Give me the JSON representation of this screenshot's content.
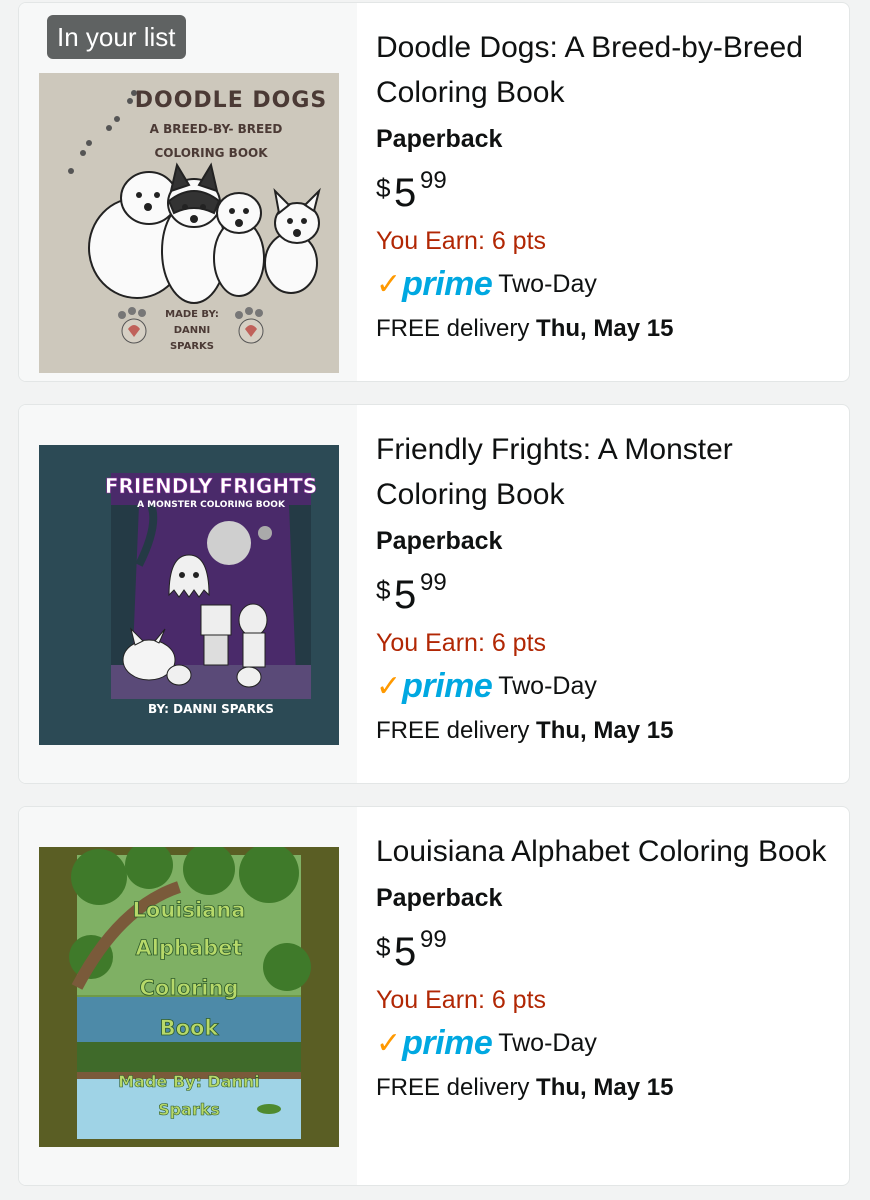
{
  "badge": {
    "label": "In your list"
  },
  "items": [
    {
      "title": "Doodle Dogs: A Breed-by-Breed Coloring Book",
      "format": "Paperback",
      "price": {
        "symbol": "$",
        "whole": "5",
        "fraction": "99"
      },
      "earn": "You Earn: 6 pts",
      "prime": {
        "word": "prime",
        "speed": "Two-Day"
      },
      "delivery": {
        "prefix": "FREE delivery ",
        "date": "Thu, May 15"
      },
      "cover": {
        "title": "DOODLE DOGS",
        "subtitle_1": "A BREED-BY- BREED",
        "subtitle_2": "COLORING BOOK",
        "credit_1": "MADE BY:",
        "credit_2": "DANNI",
        "credit_3": "SPARKS",
        "bg": "#cdc8bc"
      }
    },
    {
      "title": "Friendly Frights: A Monster Coloring Book",
      "format": "Paperback",
      "price": {
        "symbol": "$",
        "whole": "5",
        "fraction": "99"
      },
      "earn": "You Earn: 6 pts",
      "prime": {
        "word": "prime",
        "speed": "Two-Day"
      },
      "delivery": {
        "prefix": "FREE delivery ",
        "date": "Thu, May 15"
      },
      "cover": {
        "title": "FRIENDLY FRIGHTS",
        "subtitle": "A MONSTER COLORING BOOK",
        "credit": "BY: DANNI SPARKS",
        "bg": "#2c4a55"
      }
    },
    {
      "title": "Louisiana Alphabet Coloring Book",
      "format": "Paperback",
      "price": {
        "symbol": "$",
        "whole": "5",
        "fraction": "99"
      },
      "earn": "You Earn: 6 pts",
      "prime": {
        "word": "prime",
        "speed": "Two-Day"
      },
      "delivery": {
        "prefix": "FREE delivery ",
        "date": "Thu, May 15"
      },
      "cover": {
        "line_1": "Louisiana",
        "line_2": "Alphabet",
        "line_3": "Coloring",
        "line_4": "Book",
        "credit_1": "Made By: Danni",
        "credit_2": "Sparks",
        "bg": "#5a5e24"
      }
    }
  ],
  "colors": {
    "earn": "#b12704",
    "prime_blue": "#00a8e1",
    "prime_check": "#ff9900",
    "badge_bg": "#5f6262"
  }
}
